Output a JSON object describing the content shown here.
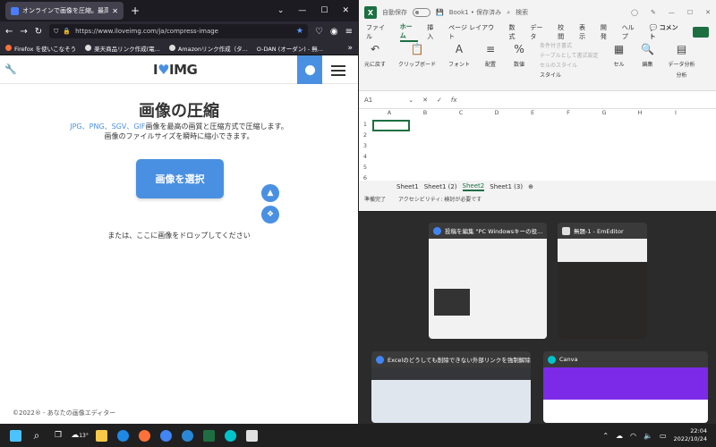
{
  "firefox": {
    "tab_title": "オンラインで画像を圧縮。最高の画",
    "url": "https://www.iloveimg.com/ja/compress-image",
    "bookmarks": [
      "Firefox を使いこなそう",
      "楽天商品リンク作成(電...",
      "Amazonリンク作成（タ...",
      "O-DAN (オーダン) - 無..."
    ]
  },
  "iloveimg": {
    "logo_left": "I",
    "logo_right": "IMG",
    "title": "画像の圧縮",
    "sub_formats": "JPG、PNG、SGV、GIF",
    "sub_rest": "画像を最高の画質と圧縮方式で圧縮します。",
    "sub2": "画像のファイルサイズを瞬時に縮小できます。",
    "select_button": "画像を選択",
    "drop_text": "または、ここに画像をドロップしてください",
    "footer": "©2022® - あなたの画像エディター"
  },
  "excel": {
    "autosave": "自動保存",
    "doc_title": "Book1 • 保存済み",
    "search": "検索",
    "menu": [
      "ファイル",
      "ホーム",
      "挿入",
      "ページ レイアウト",
      "数式",
      "データ",
      "校閲",
      "表示",
      "開発",
      "ヘルプ"
    ],
    "comment": "コメント",
    "ribbon": [
      {
        "icon": "↶",
        "label": "元に戻す"
      },
      {
        "icon": "📋",
        "label": "クリップボード"
      },
      {
        "icon": "A",
        "label": "フォント"
      },
      {
        "icon": "≡",
        "label": "配置"
      },
      {
        "icon": "%",
        "label": "数値"
      }
    ],
    "style_items": [
      "条件付き書式",
      "テーブルとして書式設定",
      "セルのスタイル"
    ],
    "style_group": "スタイル",
    "ribbon_right": [
      {
        "icon": "▦",
        "label": "セル"
      },
      {
        "icon": "🔍",
        "label": "編集"
      },
      {
        "icon": "▤",
        "label": "データ分析"
      }
    ],
    "analysis": "分析",
    "cell_ref": "A1",
    "columns": [
      "A",
      "B",
      "C",
      "D",
      "E",
      "F",
      "G",
      "H",
      "I"
    ],
    "rows": [
      "1",
      "2",
      "3",
      "4",
      "5",
      "6"
    ],
    "sheets": [
      "Sheet1",
      "Sheet1 (2)",
      "Sheet2",
      "Sheet1 (3)"
    ],
    "active_sheet": "Sheet2",
    "status_ready": "準備完了",
    "status_access": "アクセシビリティ: 検討が必要です"
  },
  "taskview": [
    {
      "title": "投稿を編集 \"PC Windowsキーの役...",
      "icon_color": "#4285f4"
    },
    {
      "title": "無題-1 - EmEditor",
      "icon_color": "#e0e0e0"
    },
    {
      "title": "Excelのどうしても削除できない外部リンクを強制解除す...",
      "icon_color": "#4285f4"
    },
    {
      "title": "Canva",
      "icon_color": "#00c4cc"
    }
  ],
  "taskbar": {
    "weather": "13°",
    "time": "22:04",
    "date": "2022/10/24"
  }
}
